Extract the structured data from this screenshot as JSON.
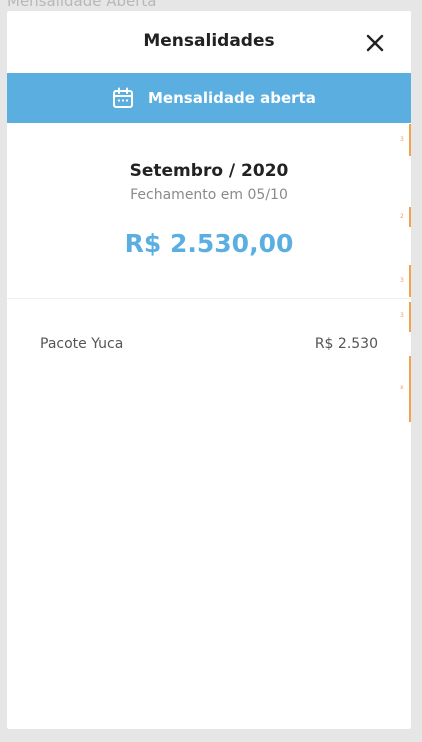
{
  "background": {
    "title": "Mensalidade Aberta"
  },
  "modal": {
    "title": "Mensalidades",
    "close_label": "×"
  },
  "banner": {
    "label": "Mensalidade aberta",
    "icon": "calendar-icon",
    "color": "#5aafe0"
  },
  "statement": {
    "month": "Setembro / 2020",
    "closing": "Fechamento em 05/10",
    "amount": "R$ 2.530,00"
  },
  "items": [
    {
      "name": "Pacote Yuca",
      "value": "R$ 2.530"
    }
  ],
  "edge_markers": [
    "3",
    "2",
    "3",
    "3",
    "x"
  ],
  "colors": {
    "accent": "#5aafe0",
    "background": "#e6e6e6",
    "edge_marker": "#f2a24b"
  }
}
